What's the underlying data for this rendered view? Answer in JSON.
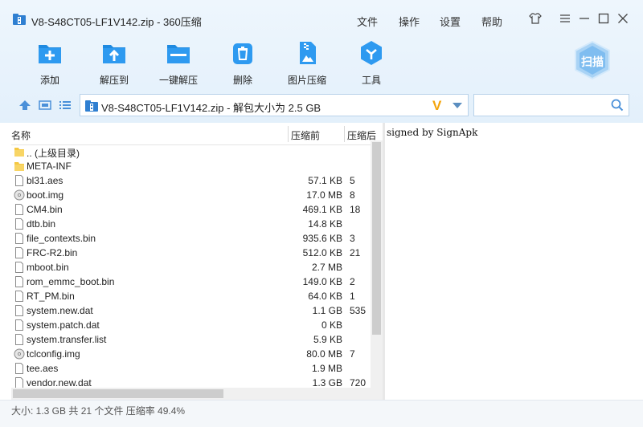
{
  "window": {
    "title": "V8-S48CT05-LF1V142.zip - 360压缩"
  },
  "menu": {
    "items": [
      "文件",
      "操作",
      "设置",
      "帮助"
    ]
  },
  "toolbar": {
    "items": [
      {
        "label": "添加",
        "icon": "add-icon"
      },
      {
        "label": "解压到",
        "icon": "extract-to-icon"
      },
      {
        "label": "一键解压",
        "icon": "one-click-extract-icon"
      },
      {
        "label": "删除",
        "icon": "delete-icon"
      },
      {
        "label": "图片压缩",
        "icon": "image-compress-icon"
      },
      {
        "label": "工具",
        "icon": "tools-icon"
      }
    ],
    "scan_label": "扫描"
  },
  "address": {
    "text": "V8-S48CT05-LF1V142.zip - 解包大小为 2.5 GB"
  },
  "search": {
    "placeholder": ""
  },
  "columns": {
    "name": "名称",
    "compressed": "压缩前",
    "after": "压缩后"
  },
  "files": [
    {
      "name": ".. (上级目录)",
      "type": "folder",
      "size": "",
      "after": ""
    },
    {
      "name": "META-INF",
      "type": "folder",
      "size": "",
      "after": ""
    },
    {
      "name": "bl31.aes",
      "type": "file",
      "size": "57.1 KB",
      "after": "5"
    },
    {
      "name": "boot.img",
      "type": "disc",
      "size": "17.0 MB",
      "after": "8"
    },
    {
      "name": "CM4.bin",
      "type": "file",
      "size": "469.1 KB",
      "after": "18"
    },
    {
      "name": "dtb.bin",
      "type": "file",
      "size": "14.8 KB",
      "after": ""
    },
    {
      "name": "file_contexts.bin",
      "type": "file",
      "size": "935.6 KB",
      "after": "3"
    },
    {
      "name": "FRC-R2.bin",
      "type": "file",
      "size": "512.0 KB",
      "after": "21"
    },
    {
      "name": "mboot.bin",
      "type": "file",
      "size": "2.7 MB",
      "after": ""
    },
    {
      "name": "rom_emmc_boot.bin",
      "type": "file",
      "size": "149.0 KB",
      "after": "2"
    },
    {
      "name": "RT_PM.bin",
      "type": "file",
      "size": "64.0 KB",
      "after": "1"
    },
    {
      "name": "system.new.dat",
      "type": "file",
      "size": "1.1 GB",
      "after": "535"
    },
    {
      "name": "system.patch.dat",
      "type": "file",
      "size": "0 KB",
      "after": ""
    },
    {
      "name": "system.transfer.list",
      "type": "file",
      "size": "5.9 KB",
      "after": ""
    },
    {
      "name": "tclconfig.img",
      "type": "disc",
      "size": "80.0 MB",
      "after": "7"
    },
    {
      "name": "tee.aes",
      "type": "file",
      "size": "1.9 MB",
      "after": ""
    },
    {
      "name": "vendor.new.dat",
      "type": "file",
      "size": "1.3 GB",
      "after": "720"
    }
  ],
  "preview": {
    "text": "signed by SignApk"
  },
  "status": {
    "text": "大小: 1.3 GB 共 21 个文件 压缩率 49.4%"
  },
  "colors": {
    "toolbar_bg": "#e3f0fb",
    "icon_blue": "#1f8ae0",
    "accent_orange": "#f4a40a"
  }
}
